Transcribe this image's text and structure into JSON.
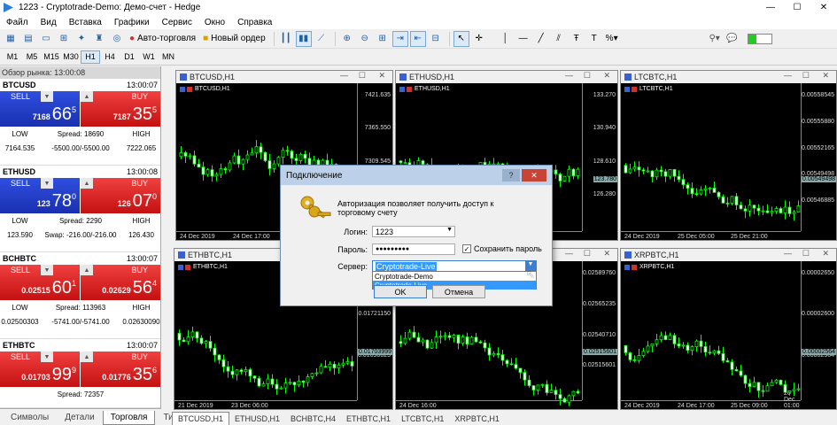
{
  "window": {
    "title": "1223 - Cryptotrade-Demo: Демо-счет - Hedge",
    "minimize": "—",
    "maximize": "☐",
    "close": "✕"
  },
  "menu": [
    "Файл",
    "Вид",
    "Вставка",
    "Графики",
    "Сервис",
    "Окно",
    "Справка"
  ],
  "toolbar": {
    "autotrade": "Авто-торговля",
    "new_order": "Новый ордер"
  },
  "timeframes": [
    "M1",
    "M5",
    "M15",
    "M30",
    "H1",
    "H4",
    "D1",
    "W1",
    "MN"
  ],
  "active_timeframe": "H1",
  "market_watch": {
    "title": "Обзор рынка: 13:00:08",
    "symbols": [
      {
        "name": "BTCUSD",
        "time": "13:00:07",
        "sell": "SELL",
        "buy": "BUY",
        "bid_small": "7168",
        "bid_big": "66",
        "bid_pip": "5",
        "ask_small": "7187",
        "ask_big": "35",
        "ask_pip": "5",
        "color": "red-blue",
        "low_label": "LOW",
        "low": "7164.535",
        "spread": "Spread: 18690",
        "swap": "-5500.00/-5500.00",
        "high_label": "HIGH",
        "high": "7222.065"
      },
      {
        "name": "ETHUSD",
        "time": "13:00:08",
        "sell": "SELL",
        "buy": "BUY",
        "bid_small": "123",
        "bid_big": "78",
        "bid_pip": "0",
        "ask_small": "126",
        "ask_big": "07",
        "ask_pip": "0",
        "low_label": "LOW",
        "low": "123.590",
        "spread": "Spread: 2290",
        "swap": "Swap: -216.00/-216.00",
        "high_label": "HIGH",
        "high": "126.430"
      },
      {
        "name": "BCHBTC",
        "time": "13:00:07",
        "sell": "SELL",
        "buy": "BUY",
        "bid_small": "0.02515",
        "bid_big": "60",
        "bid_pip": "1",
        "ask_small": "0.02629",
        "ask_big": "56",
        "ask_pip": "4",
        "low_label": "LOW",
        "low": "0.02500303",
        "spread": "Spread: 113963",
        "swap": "-5741.00/-5741.00",
        "high_label": "HIGH",
        "high": "0.02630090"
      },
      {
        "name": "ETHBTC",
        "time": "13:00:07",
        "sell": "SELL",
        "buy": "BUY",
        "bid_small": "0.01703",
        "bid_big": "99",
        "bid_pip": "9",
        "ask_small": "0.01776",
        "ask_big": "35",
        "ask_pip": "6",
        "low_label": "",
        "low": "",
        "spread": "Spread: 72357",
        "swap": "",
        "high_label": "",
        "high": ""
      }
    ]
  },
  "bottom_tabs": [
    "Символы",
    "Детали",
    "Торговля",
    "Тики"
  ],
  "active_bottom_tab": "Торговля",
  "charts": [
    {
      "tab": "BTCUSD,H1",
      "label": "BTCUSD,H1",
      "prices": [
        "7421.635",
        "7365.550",
        "7309.545",
        "7253.535"
      ],
      "times": [
        "24 Dec 2019",
        "24 Dec 17:00"
      ]
    },
    {
      "tab": "ETHUSD,H1",
      "label": "ETHUSD,H1",
      "prices": [
        "133.270",
        "130.940",
        "128.610",
        "126.280"
      ],
      "current": "123.780",
      "times": [
        "24 Dec 2019"
      ]
    },
    {
      "tab": "LTCBTC,H1",
      "label": "LTCBTC,H1",
      "prices": [
        "0.00558545",
        "0.00555880",
        "0.00552165",
        "0.00549498",
        "0.00546885"
      ],
      "current": "0.00549498",
      "times": [
        "24 Dec 2019",
        "25 Dec 05:00",
        "25 Dec 21:00"
      ]
    },
    {
      "tab": "ETHBTC,H1",
      "label": "ETHBTC,H1",
      "prices": [
        "0.01744075",
        "0.01721150",
        "0.01698025"
      ],
      "current": "0.01703999",
      "times": [
        "21 Dec 2019",
        "23 Dec 06:00"
      ]
    },
    {
      "tab": "BCHBTC,H4",
      "label": "",
      "prices": [
        "0.02589760",
        "0.02565235",
        "0.02540710",
        "0.02515601"
      ],
      "current": "0.02515601",
      "times": [
        "24 Dec 16:00"
      ]
    },
    {
      "tab": "XRPBTC,H1",
      "label": "XRPBTC,H1",
      "prices": [
        "0.00002650",
        "0.00002600",
        "0.00002564"
      ],
      "current": "0.00002564",
      "times": [
        "24 Dec 2019",
        "24 Dec 17:00",
        "25 Dec 09:00",
        "26 Dec 01:00"
      ]
    }
  ],
  "chart_tabs": [
    "BTCUSD,H1",
    "ETHUSD,H1",
    "BCHBTC,H4",
    "ETHBTC,H1",
    "LTCBTC,H1",
    "XRPBTC,H1"
  ],
  "active_chart_tab": "BTCUSD,H1",
  "dialog": {
    "title": "Подключение",
    "help": "?",
    "close": "✕",
    "description": "Авторизация позволяет получить доступ к торговому счету",
    "login_label": "Логин:",
    "login_value": "1223",
    "password_label": "Пароль:",
    "password_value": "●●●●●●●●●",
    "save_password": "Сохранить пароль",
    "save_checked": "✓",
    "server_label": "Сервер:",
    "server_value": "Cryptotrade-Live",
    "server_options": [
      "Cryptotrade-Demo",
      "Cryptotrade-Live"
    ],
    "ok": "OK",
    "cancel": "Отмена"
  },
  "colors": {
    "sell": "#2f4fe0",
    "buy": "#e02020",
    "candle": "#00ff00",
    "chart_bg": "#000000"
  }
}
